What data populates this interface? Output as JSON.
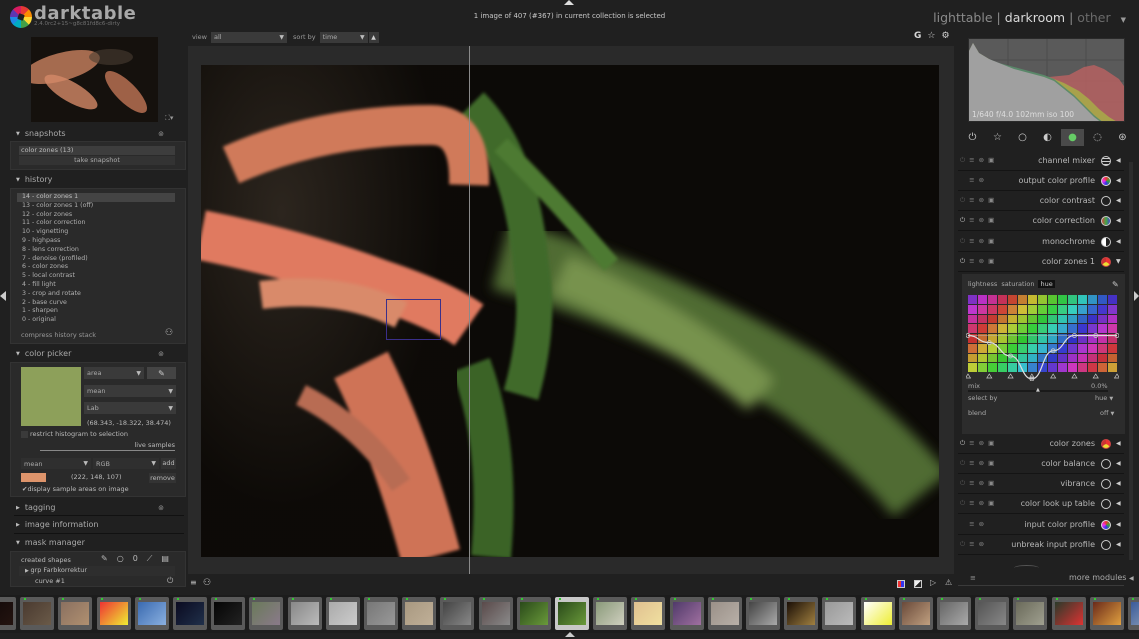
{
  "app": {
    "name": "darktable",
    "version": "2.4.0rc2+15~g8c81fd8c6-dirty",
    "selection_info": "1 image of 407 (#367) in current collection is selected"
  },
  "views": {
    "items": [
      "lighttable",
      "darkroom",
      "other"
    ],
    "active": "darkroom",
    "separator": "|",
    "dropdown_icon": "triangle-down-icon"
  },
  "toolbar": {
    "view_label": "view",
    "view_value": "all",
    "sortby_label": "sort by",
    "sortby_value": "time",
    "sort_direction_icon": "triangle-up-icon",
    "right_icons": [
      "G",
      "☆",
      "⚙"
    ]
  },
  "snapshots": {
    "title": "snapshots",
    "items": [
      "color zones (13)"
    ],
    "take_label": "take snapshot"
  },
  "history": {
    "title": "history",
    "items": [
      "14 - color zones 1",
      "13 - color zones 1 (off)",
      "12 - color zones",
      "11 - color correction",
      "10 - vignetting",
      "9 - highpass",
      "8 - lens correction",
      "7 - denoise (profiled)",
      "6 - color zones",
      "5 - local contrast",
      "4 - fill light",
      "3 - crop and rotate",
      "2 - base curve",
      "1 - sharpen",
      "0 - original"
    ],
    "selected_index": 0,
    "compress_label": "compress history stack"
  },
  "color_picker": {
    "title": "color picker",
    "swatch_color": "#8da05a",
    "mode": "area",
    "statistic": "mean",
    "color_space": "Lab",
    "values": "(68.343, -18.322, 38.474)",
    "restrict_label": "restrict histogram to selection",
    "restrict_checked": false,
    "live_samples_label": "live samples",
    "sample_stat": "mean",
    "sample_space": "RGB",
    "add_label": "add",
    "sample_color": "#de946b",
    "sample_values": "(222, 148, 107)",
    "remove_label": "remove",
    "display_label": "display sample areas on image",
    "display_checked": true
  },
  "collapsed_sections": [
    "tagging",
    "image information"
  ],
  "mask_manager": {
    "title": "mask manager",
    "created_shapes_label": "created shapes",
    "items": [
      {
        "label": "grp Farbkorrektur",
        "type": "group"
      },
      {
        "label": "curve #1",
        "type": "shape"
      }
    ]
  },
  "histogram": {
    "exif": "1/640 f/4.0 102mm iso 100"
  },
  "module_groups": [
    {
      "icon": "power-icon",
      "glyph": "⏻",
      "active": false
    },
    {
      "icon": "star-icon",
      "glyph": "☆",
      "active": false
    },
    {
      "icon": "circle-icon",
      "glyph": "○",
      "active": false
    },
    {
      "icon": "tone-icon",
      "glyph": "◐",
      "active": false
    },
    {
      "icon": "color-icon",
      "glyph": "●",
      "active": true
    },
    {
      "icon": "correct-icon",
      "glyph": "◌",
      "active": false
    },
    {
      "icon": "effect-icon",
      "glyph": "⊛",
      "active": false
    }
  ],
  "modules": [
    {
      "name": "channel mixer",
      "icon": "channel-mixer-icon",
      "expanded": false,
      "enabled": false
    },
    {
      "name": "output color profile",
      "icon": "output-profile-icon",
      "expanded": false,
      "enabled": true
    },
    {
      "name": "color contrast",
      "icon": "circle-icon",
      "expanded": false,
      "enabled": false
    },
    {
      "name": "color correction",
      "icon": "color-correction-icon",
      "expanded": false,
      "enabled": true
    },
    {
      "name": "monochrome",
      "icon": "monochrome-icon",
      "expanded": false,
      "enabled": false
    },
    {
      "name": "color zones 1",
      "icon": "color-zones-icon",
      "expanded": true,
      "enabled": true
    },
    {
      "name": "color zones",
      "icon": "color-zones-icon",
      "expanded": false,
      "enabled": true
    },
    {
      "name": "color balance",
      "icon": "circle-icon",
      "expanded": false,
      "enabled": false
    },
    {
      "name": "vibrance",
      "icon": "circle-icon",
      "expanded": false,
      "enabled": false
    },
    {
      "name": "color look up table",
      "icon": "circle-icon",
      "expanded": false,
      "enabled": false
    },
    {
      "name": "input color profile",
      "icon": "input-profile-icon",
      "expanded": false,
      "enabled": true
    },
    {
      "name": "unbreak input profile",
      "icon": "unbreak-icon",
      "expanded": false,
      "enabled": false
    }
  ],
  "color_zones": {
    "tabs": [
      "lightness",
      "saturation",
      "hue"
    ],
    "active_tab": "hue",
    "curve_nodes": [
      0.5,
      0.36,
      0.1,
      -0.35,
      0.2,
      0.5,
      0.5,
      0.5
    ],
    "mix_label": "mix",
    "mix_value": "0.0%",
    "select_by_label": "select by",
    "select_by_value": "hue",
    "blend_label": "blend",
    "blend_value": "off"
  },
  "more_modules_label": "more modules",
  "filmstrip": {
    "count_visible": 31,
    "selected_index": 15
  }
}
